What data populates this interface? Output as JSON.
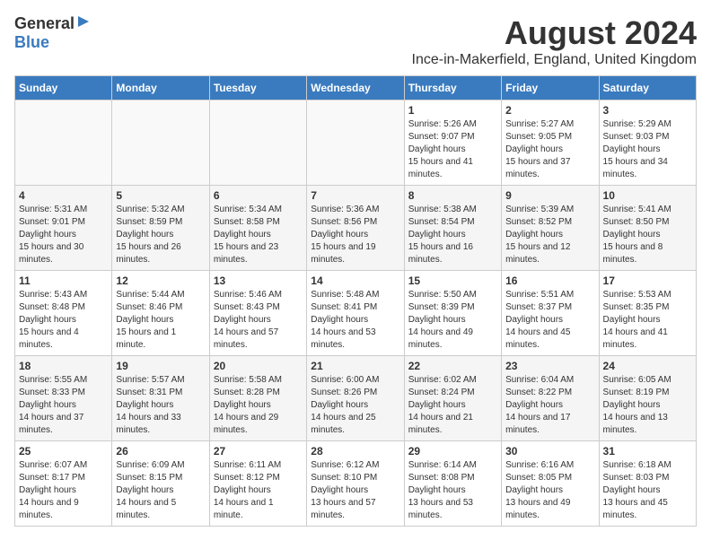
{
  "logo": {
    "general": "General",
    "blue": "Blue"
  },
  "title": "August 2024",
  "subtitle": "Ince-in-Makerfield, England, United Kingdom",
  "headers": [
    "Sunday",
    "Monday",
    "Tuesday",
    "Wednesday",
    "Thursday",
    "Friday",
    "Saturday"
  ],
  "weeks": [
    [
      {
        "day": "",
        "info": ""
      },
      {
        "day": "",
        "info": ""
      },
      {
        "day": "",
        "info": ""
      },
      {
        "day": "",
        "info": ""
      },
      {
        "day": "1",
        "sunrise": "5:26 AM",
        "sunset": "9:07 PM",
        "daylight": "15 hours and 41 minutes."
      },
      {
        "day": "2",
        "sunrise": "5:27 AM",
        "sunset": "9:05 PM",
        "daylight": "15 hours and 37 minutes."
      },
      {
        "day": "3",
        "sunrise": "5:29 AM",
        "sunset": "9:03 PM",
        "daylight": "15 hours and 34 minutes."
      }
    ],
    [
      {
        "day": "4",
        "sunrise": "5:31 AM",
        "sunset": "9:01 PM",
        "daylight": "15 hours and 30 minutes."
      },
      {
        "day": "5",
        "sunrise": "5:32 AM",
        "sunset": "8:59 PM",
        "daylight": "15 hours and 26 minutes."
      },
      {
        "day": "6",
        "sunrise": "5:34 AM",
        "sunset": "8:58 PM",
        "daylight": "15 hours and 23 minutes."
      },
      {
        "day": "7",
        "sunrise": "5:36 AM",
        "sunset": "8:56 PM",
        "daylight": "15 hours and 19 minutes."
      },
      {
        "day": "8",
        "sunrise": "5:38 AM",
        "sunset": "8:54 PM",
        "daylight": "15 hours and 16 minutes."
      },
      {
        "day": "9",
        "sunrise": "5:39 AM",
        "sunset": "8:52 PM",
        "daylight": "15 hours and 12 minutes."
      },
      {
        "day": "10",
        "sunrise": "5:41 AM",
        "sunset": "8:50 PM",
        "daylight": "15 hours and 8 minutes."
      }
    ],
    [
      {
        "day": "11",
        "sunrise": "5:43 AM",
        "sunset": "8:48 PM",
        "daylight": "15 hours and 4 minutes."
      },
      {
        "day": "12",
        "sunrise": "5:44 AM",
        "sunset": "8:46 PM",
        "daylight": "15 hours and 1 minute."
      },
      {
        "day": "13",
        "sunrise": "5:46 AM",
        "sunset": "8:43 PM",
        "daylight": "14 hours and 57 minutes."
      },
      {
        "day": "14",
        "sunrise": "5:48 AM",
        "sunset": "8:41 PM",
        "daylight": "14 hours and 53 minutes."
      },
      {
        "day": "15",
        "sunrise": "5:50 AM",
        "sunset": "8:39 PM",
        "daylight": "14 hours and 49 minutes."
      },
      {
        "day": "16",
        "sunrise": "5:51 AM",
        "sunset": "8:37 PM",
        "daylight": "14 hours and 45 minutes."
      },
      {
        "day": "17",
        "sunrise": "5:53 AM",
        "sunset": "8:35 PM",
        "daylight": "14 hours and 41 minutes."
      }
    ],
    [
      {
        "day": "18",
        "sunrise": "5:55 AM",
        "sunset": "8:33 PM",
        "daylight": "14 hours and 37 minutes."
      },
      {
        "day": "19",
        "sunrise": "5:57 AM",
        "sunset": "8:31 PM",
        "daylight": "14 hours and 33 minutes."
      },
      {
        "day": "20",
        "sunrise": "5:58 AM",
        "sunset": "8:28 PM",
        "daylight": "14 hours and 29 minutes."
      },
      {
        "day": "21",
        "sunrise": "6:00 AM",
        "sunset": "8:26 PM",
        "daylight": "14 hours and 25 minutes."
      },
      {
        "day": "22",
        "sunrise": "6:02 AM",
        "sunset": "8:24 PM",
        "daylight": "14 hours and 21 minutes."
      },
      {
        "day": "23",
        "sunrise": "6:04 AM",
        "sunset": "8:22 PM",
        "daylight": "14 hours and 17 minutes."
      },
      {
        "day": "24",
        "sunrise": "6:05 AM",
        "sunset": "8:19 PM",
        "daylight": "14 hours and 13 minutes."
      }
    ],
    [
      {
        "day": "25",
        "sunrise": "6:07 AM",
        "sunset": "8:17 PM",
        "daylight": "14 hours and 9 minutes."
      },
      {
        "day": "26",
        "sunrise": "6:09 AM",
        "sunset": "8:15 PM",
        "daylight": "14 hours and 5 minutes."
      },
      {
        "day": "27",
        "sunrise": "6:11 AM",
        "sunset": "8:12 PM",
        "daylight": "14 hours and 1 minute."
      },
      {
        "day": "28",
        "sunrise": "6:12 AM",
        "sunset": "8:10 PM",
        "daylight": "13 hours and 57 minutes."
      },
      {
        "day": "29",
        "sunrise": "6:14 AM",
        "sunset": "8:08 PM",
        "daylight": "13 hours and 53 minutes."
      },
      {
        "day": "30",
        "sunrise": "6:16 AM",
        "sunset": "8:05 PM",
        "daylight": "13 hours and 49 minutes."
      },
      {
        "day": "31",
        "sunrise": "6:18 AM",
        "sunset": "8:03 PM",
        "daylight": "13 hours and 45 minutes."
      }
    ]
  ],
  "labels": {
    "sunrise": "Sunrise:",
    "sunset": "Sunset:",
    "daylight": "Daylight hours"
  }
}
